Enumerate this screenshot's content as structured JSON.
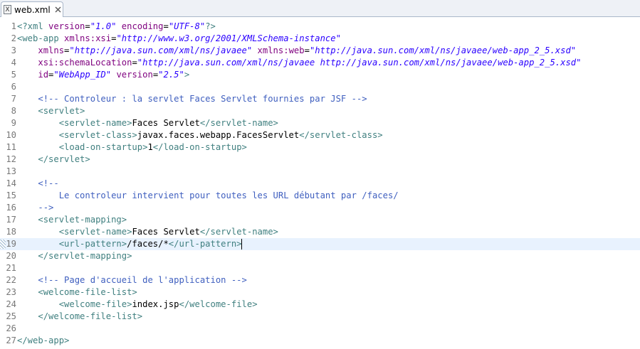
{
  "tab": {
    "title": "web.xml",
    "icon": "xml-file-icon",
    "close_icon": "close-icon"
  },
  "editor": {
    "current_line": 19,
    "lines": [
      {
        "n": "1",
        "tokens": [
          [
            "decl",
            "<?xml "
          ],
          [
            "attr",
            "version"
          ],
          [
            "txt",
            "="
          ],
          [
            "val",
            "\"1.0\""
          ],
          [
            "txt",
            " "
          ],
          [
            "attr",
            "encoding"
          ],
          [
            "txt",
            "="
          ],
          [
            "val",
            "\"UTF-8\""
          ],
          [
            "decl",
            "?>"
          ]
        ]
      },
      {
        "n": "2",
        "tokens": [
          [
            "tag",
            "<web-app "
          ],
          [
            "attr",
            "xmlns:xsi"
          ],
          [
            "txt",
            "="
          ],
          [
            "val",
            "\"http://www.w3.org/2001/XMLSchema-instance\""
          ]
        ]
      },
      {
        "n": "3",
        "tokens": [
          [
            "txt",
            "    "
          ],
          [
            "attr",
            "xmlns"
          ],
          [
            "txt",
            "="
          ],
          [
            "val",
            "\"http://java.sun.com/xml/ns/javaee\""
          ],
          [
            "txt",
            " "
          ],
          [
            "attr",
            "xmlns:web"
          ],
          [
            "txt",
            "="
          ],
          [
            "val",
            "\"http://java.sun.com/xml/ns/javaee/web-app_2_5.xsd\""
          ]
        ]
      },
      {
        "n": "4",
        "tokens": [
          [
            "txt",
            "    "
          ],
          [
            "attr",
            "xsi:schemaLocation"
          ],
          [
            "txt",
            "="
          ],
          [
            "val",
            "\"http://java.sun.com/xml/ns/javaee http://java.sun.com/xml/ns/javaee/web-app_2_5.xsd\""
          ]
        ]
      },
      {
        "n": "5",
        "tokens": [
          [
            "txt",
            "    "
          ],
          [
            "attr",
            "id"
          ],
          [
            "txt",
            "="
          ],
          [
            "val",
            "\"WebApp_ID\""
          ],
          [
            "txt",
            " "
          ],
          [
            "attr",
            "version"
          ],
          [
            "txt",
            "="
          ],
          [
            "val",
            "\"2.5\""
          ],
          [
            "tag",
            ">"
          ]
        ]
      },
      {
        "n": "6",
        "tokens": []
      },
      {
        "n": "7",
        "tokens": [
          [
            "txt",
            "    "
          ],
          [
            "com",
            "<!-- Controleur : la servlet Faces Servlet fournies par JSF -->"
          ]
        ]
      },
      {
        "n": "8",
        "tokens": [
          [
            "txt",
            "    "
          ],
          [
            "tag",
            "<servlet>"
          ]
        ]
      },
      {
        "n": "9",
        "tokens": [
          [
            "txt",
            "        "
          ],
          [
            "tag",
            "<servlet-name>"
          ],
          [
            "txt",
            "Faces Servlet"
          ],
          [
            "tag",
            "</servlet-name>"
          ]
        ]
      },
      {
        "n": "10",
        "tokens": [
          [
            "txt",
            "        "
          ],
          [
            "tag",
            "<servlet-class>"
          ],
          [
            "txt",
            "javax.faces.webapp.FacesServlet"
          ],
          [
            "tag",
            "</servlet-class>"
          ]
        ]
      },
      {
        "n": "11",
        "tokens": [
          [
            "txt",
            "        "
          ],
          [
            "tag",
            "<load-on-startup>"
          ],
          [
            "txt",
            "1"
          ],
          [
            "tag",
            "</load-on-startup>"
          ]
        ]
      },
      {
        "n": "12",
        "tokens": [
          [
            "txt",
            "    "
          ],
          [
            "tag",
            "</servlet>"
          ]
        ]
      },
      {
        "n": "13",
        "tokens": []
      },
      {
        "n": "14",
        "tokens": [
          [
            "txt",
            "    "
          ],
          [
            "com",
            "<!--"
          ]
        ]
      },
      {
        "n": "15",
        "tokens": [
          [
            "txt",
            "        "
          ],
          [
            "com",
            "Le controleur intervient pour toutes les URL débutant par /faces/"
          ]
        ]
      },
      {
        "n": "16",
        "tokens": [
          [
            "txt",
            "    "
          ],
          [
            "com",
            "-->"
          ]
        ]
      },
      {
        "n": "17",
        "tokens": [
          [
            "txt",
            "    "
          ],
          [
            "tag",
            "<servlet-mapping>"
          ]
        ]
      },
      {
        "n": "18",
        "tokens": [
          [
            "txt",
            "        "
          ],
          [
            "tag",
            "<servlet-name>"
          ],
          [
            "txt",
            "Faces Servlet"
          ],
          [
            "tag",
            "</servlet-name>"
          ]
        ]
      },
      {
        "n": "19",
        "tokens": [
          [
            "txt",
            "        "
          ],
          [
            "tag",
            "<url-pattern>"
          ],
          [
            "txt",
            "/faces/*"
          ],
          [
            "tag",
            "</url-pattern>"
          ]
        ]
      },
      {
        "n": "20",
        "tokens": [
          [
            "txt",
            "    "
          ],
          [
            "tag",
            "</servlet-mapping>"
          ]
        ]
      },
      {
        "n": "21",
        "tokens": []
      },
      {
        "n": "22",
        "tokens": [
          [
            "txt",
            "    "
          ],
          [
            "com",
            "<!-- Page d'accueil de l'application -->"
          ]
        ]
      },
      {
        "n": "23",
        "tokens": [
          [
            "txt",
            "    "
          ],
          [
            "tag",
            "<welcome-file-list>"
          ]
        ]
      },
      {
        "n": "24",
        "tokens": [
          [
            "txt",
            "        "
          ],
          [
            "tag",
            "<welcome-file>"
          ],
          [
            "txt",
            "index.jsp"
          ],
          [
            "tag",
            "</welcome-file>"
          ]
        ]
      },
      {
        "n": "25",
        "tokens": [
          [
            "txt",
            "    "
          ],
          [
            "tag",
            "</welcome-file-list>"
          ]
        ]
      },
      {
        "n": "26",
        "tokens": []
      },
      {
        "n": "27",
        "tokens": [
          [
            "tag",
            "</web-app>"
          ]
        ]
      }
    ]
  }
}
